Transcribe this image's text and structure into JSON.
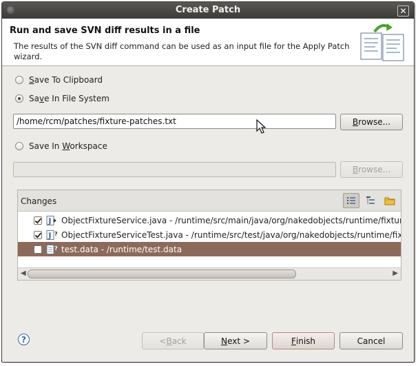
{
  "window": {
    "title": "Create Patch",
    "close_symbol": "✕"
  },
  "header": {
    "title": "Run and save SVN diff results in a file",
    "description": "The results of the SVN diff command can be used as an input file for the Apply Patch wizard."
  },
  "options": {
    "clipboard": {
      "pre": "",
      "mnemonic": "S",
      "post": "ave To Clipboard",
      "checked": false
    },
    "filesystem": {
      "pre": "Sa",
      "mnemonic": "v",
      "post": "e In File System",
      "checked": true
    },
    "workspace": {
      "pre": "Save In ",
      "mnemonic": "W",
      "post": "orkspace",
      "checked": false
    }
  },
  "filesystem_path": {
    "value": "/home/rcm/patches/fixture-patches.txt"
  },
  "workspace_path": {
    "value": ""
  },
  "browse": {
    "mnemonic": "B",
    "rest": "rowse..."
  },
  "changes": {
    "label": "Changes",
    "rows": [
      {
        "text": "ObjectFixtureService.java - /runtime/src/main/java/org/nakedobjects/runtime/fixture",
        "checked": true,
        "selected": false,
        "icon": "java-outgoing-file-icon"
      },
      {
        "text": "ObjectFixtureServiceTest.java - /runtime/src/test/java/org/nakedobjects/runtime/fixture",
        "checked": true,
        "selected": false,
        "icon": "java-unversioned-file-icon"
      },
      {
        "text": "test.data - /runtime/test.data",
        "checked": false,
        "selected": true,
        "icon": "text-unversioned-file-icon"
      }
    ]
  },
  "buttons": {
    "back": {
      "prefix": "< ",
      "mnemonic": "B",
      "rest": "ack"
    },
    "next": {
      "mnemonic": "N",
      "rest": "ext >"
    },
    "finish": {
      "mnemonic": "F",
      "rest": "inish"
    },
    "cancel": {
      "label": "Cancel"
    }
  },
  "help": {
    "symbol": "?"
  },
  "colors": {
    "selection": "#8c6a5a",
    "titlebar": "#3d3b38",
    "dialog_bg": "#edebe7"
  }
}
